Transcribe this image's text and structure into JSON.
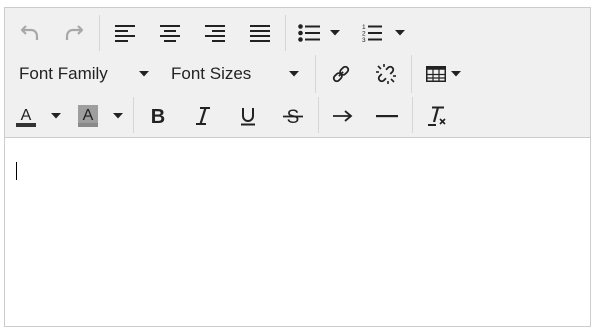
{
  "toolbar": {
    "font_family": {
      "label": "Font Family"
    },
    "font_size": {
      "label": "Font Sizes"
    }
  },
  "icons": {
    "undo": "undo-icon",
    "redo": "redo-icon",
    "align_left": "align-left-icon",
    "align_center": "align-center-icon",
    "align_right": "align-right-icon",
    "align_justify": "align-justify-icon",
    "bullet_list": "bullet-list-icon",
    "numbered_list": "numbered-list-icon",
    "link": "link-icon",
    "unlink": "unlink-icon",
    "table": "table-icon",
    "font_color": "font-color-icon",
    "background_color": "background-color-icon",
    "bold": "bold-icon",
    "italic": "italic-icon",
    "underline": "underline-icon",
    "strikethrough": "strikethrough-icon",
    "indent": "indent-arrow-icon",
    "horizontal_rule": "horizontal-rule-icon",
    "clear_formatting": "clear-formatting-icon"
  },
  "colors": {
    "toolbar_bg": "#f0f0f0",
    "border": "#cccccc",
    "icon": "#222222",
    "icon_disabled": "#a8a8a8",
    "font_color_swatch": "#333333",
    "background_color_swatch": "#9e9e9e"
  },
  "editor": {
    "content": ""
  }
}
